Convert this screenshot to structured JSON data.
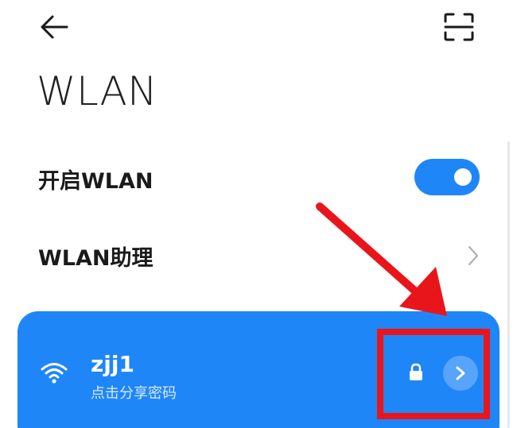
{
  "header": {
    "back_icon": "arrow-left-icon",
    "scan_icon": "scan-icon"
  },
  "page_title": "WLAN",
  "wlan_toggle": {
    "label": "开启WLAN",
    "on": true,
    "color": "#1f86f8"
  },
  "assistant": {
    "label": "WLAN助理"
  },
  "connected_network": {
    "name": "zjj1",
    "subtitle": "点击分享密码",
    "card_color": "#1f86f8",
    "secured": true
  },
  "annotation": {
    "color": "#e8161b"
  }
}
